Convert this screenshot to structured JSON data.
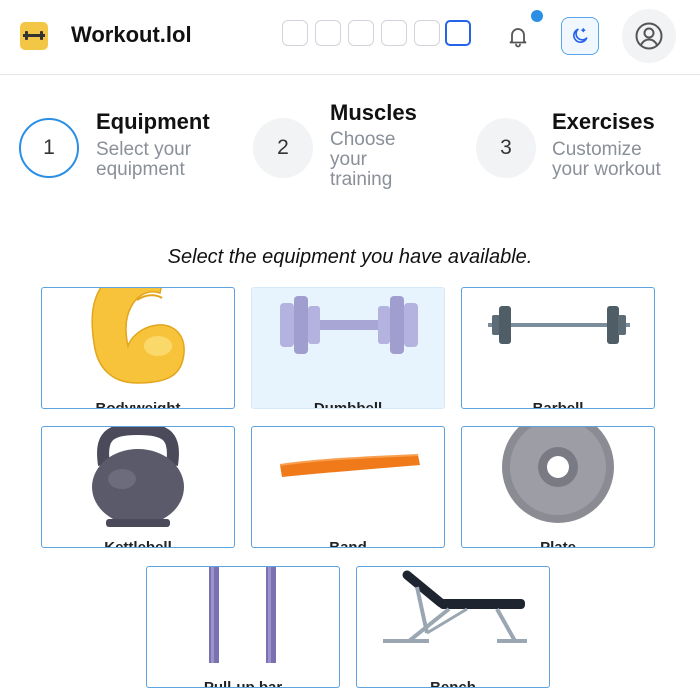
{
  "header": {
    "brand": "Workout.lol",
    "logo_icon": "dumbbell-icon",
    "logo_color": "#f3c645",
    "accent_color": "#2b8fe6",
    "notification_icon": "bell-icon",
    "theme_icon": "moon-icon",
    "avatar_icon": "user-circle-icon"
  },
  "steps": [
    {
      "number": "1",
      "title": "Equipment",
      "description": "Select your equipment",
      "active": true
    },
    {
      "number": "2",
      "title": "Muscles",
      "description": "Choose your training",
      "active": false
    },
    {
      "number": "3",
      "title": "Exercises",
      "description": "Customize your workout",
      "active": false
    }
  ],
  "prompt": "Select the equipment you have available.",
  "equipment": [
    {
      "label": "Bodyweight",
      "icon": "flexed-biceps-icon",
      "selected": false
    },
    {
      "label": "Dumbbell",
      "icon": "dumbbell-icon",
      "selected": true
    },
    {
      "label": "Barbell",
      "icon": "barbell-icon",
      "selected": false
    },
    {
      "label": "Kettlebell",
      "icon": "kettlebell-icon",
      "selected": false
    },
    {
      "label": "Band",
      "icon": "resistance-band-icon",
      "selected": false
    },
    {
      "label": "Plate",
      "icon": "weight-plate-icon",
      "selected": false
    },
    {
      "label": "Pull-up bar",
      "icon": "pull-up-bar-icon",
      "selected": false
    },
    {
      "label": "Bench",
      "icon": "bench-icon",
      "selected": false
    }
  ]
}
